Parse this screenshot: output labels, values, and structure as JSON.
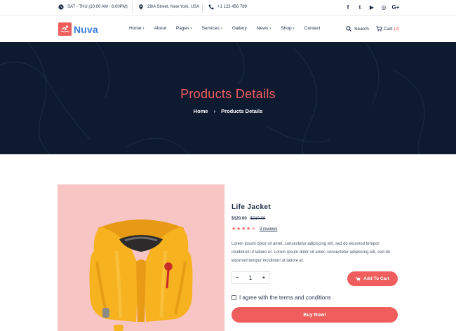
{
  "topbar": {
    "hours": "SAT - THU (10:00 AM - 6:00PM)",
    "address": "28/A Street, New York, USA",
    "phone": "+1 123 456 789",
    "social": [
      "f",
      "t",
      "▶",
      "◎",
      "G+"
    ]
  },
  "header": {
    "logo": "Nuva",
    "nav": [
      "Home ›",
      "About",
      "Pages ›",
      "Services ›",
      "Gallery",
      "News ›",
      "Shop ›",
      "Contact"
    ],
    "search_label": "Search",
    "cart_label": "Cart",
    "cart_count": "(2)"
  },
  "hero": {
    "title": "Products Details",
    "breadcrumb": {
      "home": "Home",
      "sep": "›",
      "current": "Products Details"
    }
  },
  "product": {
    "name": "Life Jacket",
    "price": "$120.00",
    "old_price": "$210.00",
    "rating": 4.5,
    "reviews": "3 reviews",
    "description": "Lorem ipsum dolor sit amet, consectetur adipiscing elit, sed do eiusmod tempor incididunt ut labore et. Lorem ipsum dolor sit amet, consectetur adipiscing elit, sed do eiusmod tempor incididunt ut labore et.",
    "quantity": "1",
    "minus": "−",
    "plus": "+",
    "add_to_cart": "Add To Cart",
    "agree": "I agree with the terms and conditions",
    "buy_now": "Buy Now!"
  },
  "colors": {
    "accent": "#ef5e5c",
    "hero_bg": "#0d1a30",
    "image_bg": "#f7c5c4",
    "logo_text": "#3b7ee0"
  }
}
